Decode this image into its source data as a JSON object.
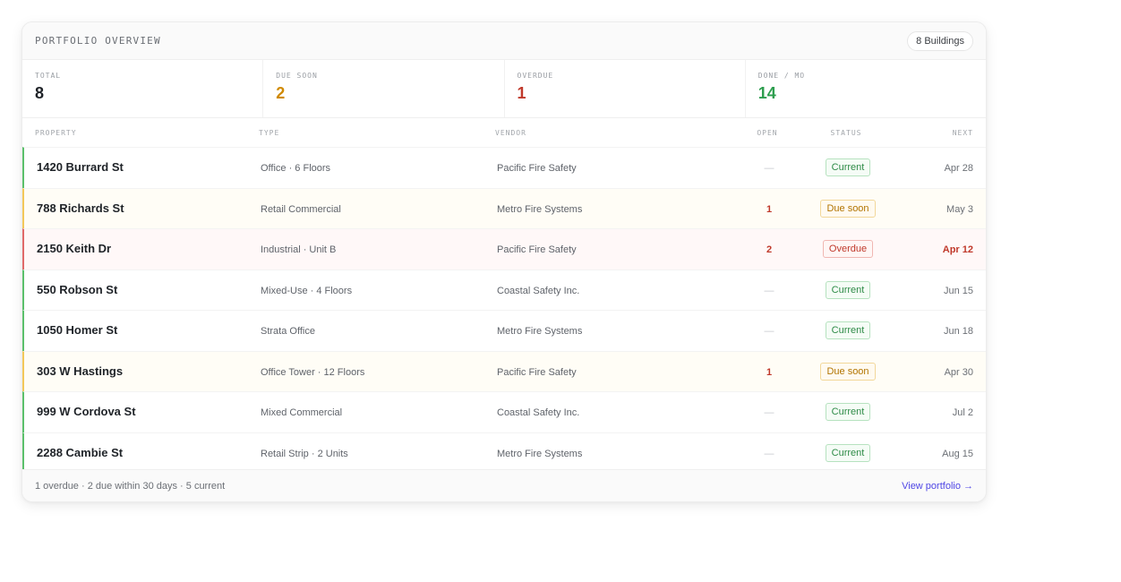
{
  "header": {
    "title": "PORTFOLIO OVERVIEW",
    "count_badge": "8 Buildings"
  },
  "stats": [
    {
      "label": "TOTAL",
      "value": "8",
      "color": "#1f2328"
    },
    {
      "label": "DUE SOON",
      "value": "2",
      "color": "#d08a00"
    },
    {
      "label": "OVERDUE",
      "value": "1",
      "color": "#c0392b"
    },
    {
      "label": "DONE / MO",
      "value": "14",
      "color": "#2e9e4f"
    }
  ],
  "columns": {
    "property": "PROPERTY",
    "type": "TYPE",
    "vendor": "VENDOR",
    "open": "OPEN",
    "status": "STATUS",
    "next": "NEXT"
  },
  "rows": [
    {
      "property": "1420 Burrard St",
      "type": "Office · 6 Floors",
      "vendor": "Pacific Fire Safety",
      "open": "—",
      "status": "Current",
      "state": "current",
      "next": "Apr 28"
    },
    {
      "property": "788 Richards St",
      "type": "Retail Commercial",
      "vendor": "Metro Fire Systems",
      "open": "1",
      "status": "Due soon",
      "state": "due",
      "next": "May 3"
    },
    {
      "property": "2150 Keith Dr",
      "type": "Industrial · Unit B",
      "vendor": "Pacific Fire Safety",
      "open": "2",
      "status": "Overdue",
      "state": "overdue",
      "next": "Apr 12"
    },
    {
      "property": "550 Robson St",
      "type": "Mixed-Use · 4 Floors",
      "vendor": "Coastal Safety Inc.",
      "open": "—",
      "status": "Current",
      "state": "current",
      "next": "Jun 15"
    },
    {
      "property": "1050 Homer St",
      "type": "Strata Office",
      "vendor": "Metro Fire Systems",
      "open": "—",
      "status": "Current",
      "state": "current",
      "next": "Jun 18"
    },
    {
      "property": "303 W Hastings",
      "type": "Office Tower · 12 Floors",
      "vendor": "Pacific Fire Safety",
      "open": "1",
      "status": "Due soon",
      "state": "due",
      "next": "Apr 30"
    },
    {
      "property": "999 W Cordova St",
      "type": "Mixed Commercial",
      "vendor": "Coastal Safety Inc.",
      "open": "—",
      "status": "Current",
      "state": "current",
      "next": "Jul 2"
    },
    {
      "property": "2288 Cambie St",
      "type": "Retail Strip · 2 Units",
      "vendor": "Metro Fire Systems",
      "open": "—",
      "status": "Current",
      "state": "current",
      "next": "Aug 15"
    }
  ],
  "footer": {
    "summary": "1 overdue · 2 due within 30 days · 5 current",
    "link_label": "View portfolio →"
  },
  "colors": {
    "accent": "#4f46e5",
    "current": "#2e8b47",
    "due": "#b27400",
    "overdue": "#c0392b"
  }
}
